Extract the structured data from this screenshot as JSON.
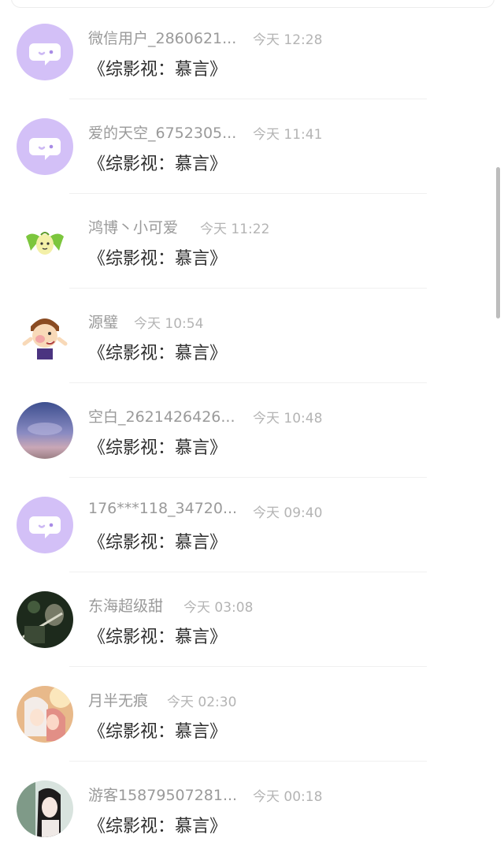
{
  "colors": {
    "accent_purple": "#cdb9f4",
    "name_gray": "#9a9a9a",
    "time_gray": "#b4b4b4",
    "message_dark": "#2e2e2e"
  },
  "comments": [
    {
      "avatar": "chat-bubble-avatar",
      "name": "微信用户_2860621...",
      "time": "今天 12:28",
      "message": "《综影视：慕言》"
    },
    {
      "avatar": "chat-bubble-avatar",
      "name": "爱的天空_6752305...",
      "time": "今天 11:41",
      "message": "《综影视：慕言》"
    },
    {
      "avatar": "leaf-sprout-avatar",
      "name": "鸿博丶小可爱",
      "time": "今天 11:22",
      "message": "《综影视：慕言》"
    },
    {
      "avatar": "cartoon-boy-avatar",
      "name": "源璧",
      "time": "今天 10:54",
      "message": "《综影视：慕言》"
    },
    {
      "avatar": "sky-photo-avatar",
      "name": "空白_2621426426...",
      "time": "今天 10:48",
      "message": "《综影视：慕言》"
    },
    {
      "avatar": "chat-bubble-avatar",
      "name": "176***118_34720...",
      "time": "今天 09:40",
      "message": "《综影视：慕言》"
    },
    {
      "avatar": "dark-photo-avatar",
      "name": "东海超级甜",
      "time": "今天 03:08",
      "message": "《综影视：慕言》"
    },
    {
      "avatar": "anime-couple-avatar",
      "name": "月半无痕",
      "time": "今天 02:30",
      "message": "《综影视：慕言》"
    },
    {
      "avatar": "girl-photo-avatar",
      "name": "游客15879507281...",
      "time": "今天 00:18",
      "message": "《综影视：慕言》"
    }
  ]
}
